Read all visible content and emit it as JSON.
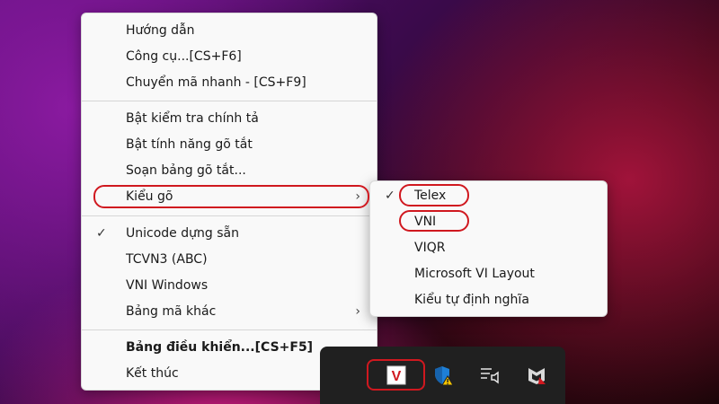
{
  "main_menu": {
    "items": [
      {
        "label": "Hướng dẫn"
      },
      {
        "label": "Công cụ...[CS+F6]"
      },
      {
        "label": "Chuyển mã nhanh - [CS+F9]"
      },
      {
        "label": "Bật kiểm tra chính tả"
      },
      {
        "label": "Bật tính năng gõ tắt"
      },
      {
        "label": "Soạn bảng gõ tắt..."
      },
      {
        "label": "Kiểu gõ",
        "submenu": true
      },
      {
        "label": "Unicode dựng sẵn",
        "checked": true
      },
      {
        "label": "TCVN3 (ABC)"
      },
      {
        "label": "VNI Windows"
      },
      {
        "label": "Bảng mã khác",
        "submenu": true
      },
      {
        "label": "Bảng điều khiển...[CS+F5]",
        "bold": true
      },
      {
        "label": "Kết thúc"
      }
    ]
  },
  "sub_menu": {
    "items": [
      {
        "label": "Telex",
        "checked": true
      },
      {
        "label": "VNI"
      },
      {
        "label": "VIQR"
      },
      {
        "label": "Microsoft VI Layout"
      },
      {
        "label": "Kiểu tự định nghĩa"
      }
    ]
  },
  "glyphs": {
    "check": "✓",
    "arrow": "›"
  },
  "highlight_color": "#d0181f",
  "tray": {
    "icons": [
      "unikey-v-icon",
      "defender-shield-warning-icon",
      "network-volume-icon",
      "mcafee-icon"
    ],
    "unikey_letter": "V"
  }
}
